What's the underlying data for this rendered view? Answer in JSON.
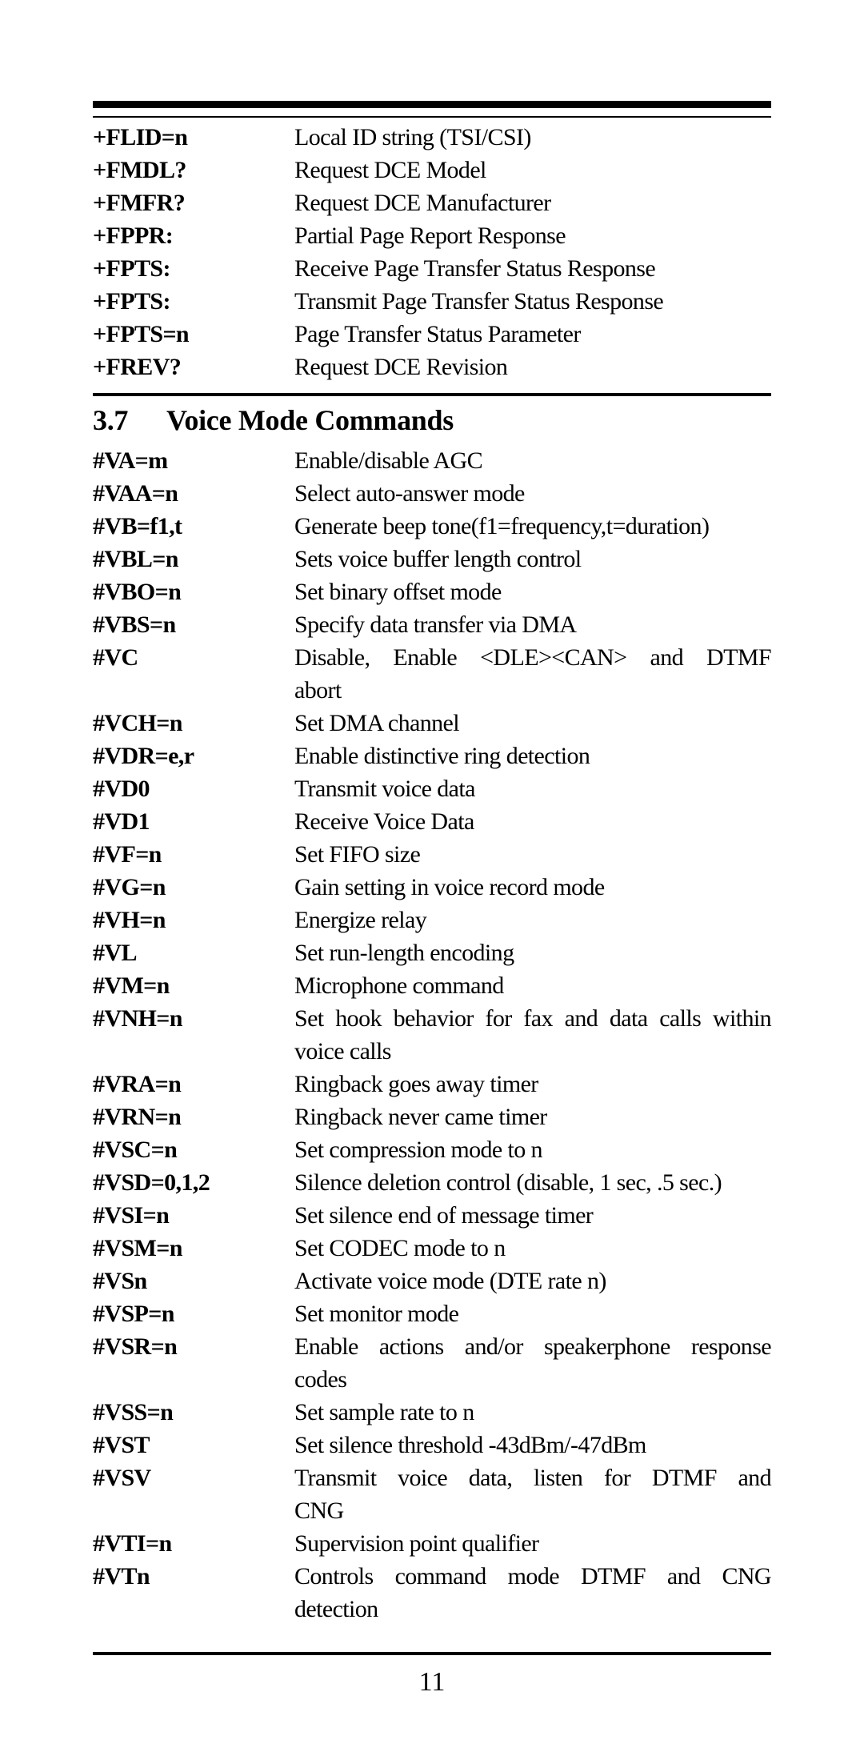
{
  "fax_commands": [
    {
      "cmd": "+FLID=n",
      "desc": [
        "Local ID string (TSI/CSI)"
      ]
    },
    {
      "cmd": "+FMDL?",
      "desc": [
        "Request DCE Model"
      ]
    },
    {
      "cmd": "+FMFR?",
      "desc": [
        "Request DCE Manufacturer"
      ]
    },
    {
      "cmd": "+FPPR:",
      "desc": [
        "Partial Page Report Response"
      ]
    },
    {
      "cmd": "+FPTS:",
      "desc": [
        "Receive Page Transfer Status Response"
      ]
    },
    {
      "cmd": "+FPTS:",
      "desc": [
        "Transmit Page Transfer Status Response"
      ]
    },
    {
      "cmd": "+FPTS=n",
      "desc": [
        "Page Transfer Status Parameter"
      ]
    },
    {
      "cmd": "+FREV?",
      "desc": [
        "Request DCE Revision"
      ]
    }
  ],
  "section": {
    "number": "3.7",
    "title": "Voice Mode Commands"
  },
  "voice_commands": [
    {
      "cmd": "#VA=m",
      "desc": [
        "Enable/disable AGC"
      ]
    },
    {
      "cmd": "#VAA=n",
      "desc": [
        "Select auto-answer mode"
      ]
    },
    {
      "cmd": "#VB=f1,t",
      "desc": [
        "Generate beep tone(f1=frequency,t=duration)"
      ]
    },
    {
      "cmd": "#VBL=n",
      "desc": [
        "Sets voice buffer length control"
      ]
    },
    {
      "cmd": "#VBO=n",
      "desc": [
        "Set binary offset mode"
      ]
    },
    {
      "cmd": "#VBS=n",
      "desc": [
        "Specify data transfer via DMA"
      ]
    },
    {
      "cmd": "#VC",
      "desc": [
        "Disable, Enable <DLE><CAN> and DTMF",
        "abort"
      ]
    },
    {
      "cmd": "#VCH=n",
      "desc": [
        "Set DMA channel"
      ]
    },
    {
      "cmd": "#VDR=e,r",
      "desc": [
        "Enable distinctive ring detection"
      ]
    },
    {
      "cmd": "#VD0",
      "desc": [
        "Transmit voice data"
      ]
    },
    {
      "cmd": "#VD1",
      "desc": [
        "Receive Voice Data"
      ]
    },
    {
      "cmd": "#VF=n",
      "desc": [
        "Set FIFO size"
      ]
    },
    {
      "cmd": "#VG=n",
      "desc": [
        "Gain setting in voice record mode"
      ]
    },
    {
      "cmd": "#VH=n",
      "desc": [
        "Energize relay"
      ]
    },
    {
      "cmd": "#VL",
      "desc": [
        "Set run-length encoding"
      ]
    },
    {
      "cmd": "#VM=n",
      "desc": [
        "Microphone command"
      ]
    },
    {
      "cmd": "#VNH=n",
      "desc": [
        "Set hook behavior for fax and data calls within",
        "voice calls"
      ]
    },
    {
      "cmd": "#VRA=n",
      "desc": [
        "Ringback goes away timer"
      ]
    },
    {
      "cmd": "#VRN=n",
      "desc": [
        "Ringback never came timer"
      ]
    },
    {
      "cmd": "#VSC=n",
      "desc": [
        "Set compression mode to n"
      ]
    },
    {
      "cmd": "#VSD=0,1,2",
      "desc": [
        "Silence deletion control (disable, 1 sec, .5 sec.)"
      ]
    },
    {
      "cmd": "#VSI=n",
      "desc": [
        "Set silence end of message timer"
      ]
    },
    {
      "cmd": "#VSM=n",
      "desc": [
        "Set CODEC mode to n"
      ]
    },
    {
      "cmd": "#VSn",
      "desc": [
        "Activate voice mode (DTE rate n)"
      ]
    },
    {
      "cmd": "#VSP=n",
      "desc": [
        "Set monitor mode"
      ]
    },
    {
      "cmd": "#VSR=n",
      "desc": [
        "Enable actions and/or speakerphone response",
        "codes"
      ]
    },
    {
      "cmd": "#VSS=n",
      "desc": [
        "Set sample rate to n"
      ]
    },
    {
      "cmd": "#VST",
      "desc": [
        "Set silence threshold -43dBm/-47dBm"
      ]
    },
    {
      "cmd": "#VSV",
      "desc": [
        "Transmit voice data, listen for DTMF and",
        "CNG"
      ]
    },
    {
      "cmd": "#VTI=n",
      "desc": [
        "Supervision point qualifier"
      ]
    },
    {
      "cmd": "#VTn",
      "desc": [
        "Controls command mode DTMF and CNG",
        "detection"
      ]
    }
  ],
  "footer": {
    "page_number": "11"
  }
}
